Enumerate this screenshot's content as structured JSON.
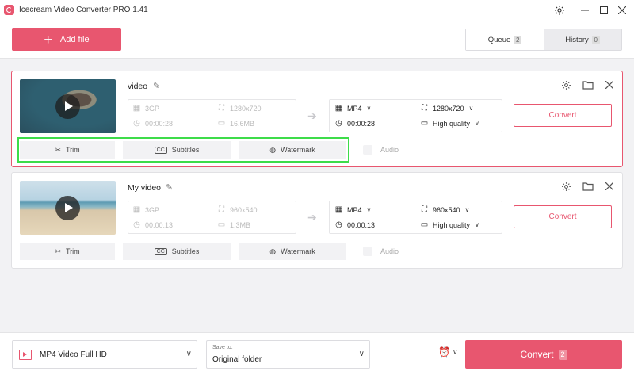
{
  "window": {
    "title": "Icecream Video Converter PRO 1.41"
  },
  "toolbar": {
    "add_file_label": "Add file"
  },
  "tabs": [
    {
      "label": "Queue",
      "count": "2"
    },
    {
      "label": "History",
      "count": "0"
    }
  ],
  "items": [
    {
      "name": "video",
      "source": {
        "format": "3GP",
        "resolution": "1280x720",
        "duration": "00:00:28",
        "size": "16.6MB"
      },
      "output": {
        "format": "MP4",
        "resolution": "1280x720",
        "duration": "00:00:28",
        "quality": "High quality"
      },
      "convert_label": "Convert",
      "tools": {
        "trim": "Trim",
        "subtitles": "Subtitles",
        "watermark": "Watermark",
        "audio": "Audio"
      }
    },
    {
      "name": "My video",
      "source": {
        "format": "3GP",
        "resolution": "960x540",
        "duration": "00:00:13",
        "size": "1.3MB"
      },
      "output": {
        "format": "MP4",
        "resolution": "960x540",
        "duration": "00:00:13",
        "quality": "High quality"
      },
      "convert_label": "Convert",
      "tools": {
        "trim": "Trim",
        "subtitles": "Subtitles",
        "watermark": "Watermark",
        "audio": "Audio"
      }
    }
  ],
  "bottom": {
    "format_label": "MP4 Video Full HD",
    "save_to_label": "Save to:",
    "save_to_value": "Original folder",
    "convert_all_label": "Convert",
    "convert_all_count": "2"
  },
  "colors": {
    "accent": "#e8566f",
    "highlight": "#3ddc4a"
  }
}
